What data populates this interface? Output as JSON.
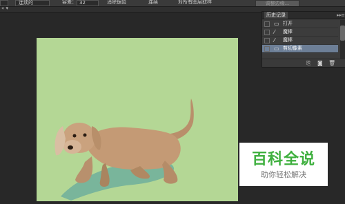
{
  "options_bar": {
    "mode_value": "连续的",
    "tolerance_label": "容差：",
    "tolerance_value": "32",
    "options": [
      "消除锯齿",
      "连续",
      "对所有图层取样"
    ],
    "refine_button": "调整边缘..."
  },
  "tab_strip": {
    "arrows": "« ▾"
  },
  "history_panel": {
    "title": "历史记录",
    "collapse_icon": "▸▸",
    "menu_icon": "≡",
    "items": [
      {
        "label": "打开",
        "icon": "document-icon"
      },
      {
        "label": "魔棒",
        "icon": "magic-wand-icon"
      },
      {
        "label": "魔棒",
        "icon": "magic-wand-icon"
      },
      {
        "label": "剪切像素",
        "icon": "document-icon",
        "selected": true
      }
    ],
    "footer_icons": [
      "new-document-from-state-icon",
      "new-snapshot-icon",
      "trash-icon"
    ]
  },
  "watermark": {
    "title": "百科全说",
    "subtitle": "助你轻松解决"
  },
  "colors": {
    "workspace_bg": "#282828",
    "canvas_bg": "#b4d795",
    "selected_row": "#6d7f97",
    "watermark_green": "#3fb03f"
  }
}
